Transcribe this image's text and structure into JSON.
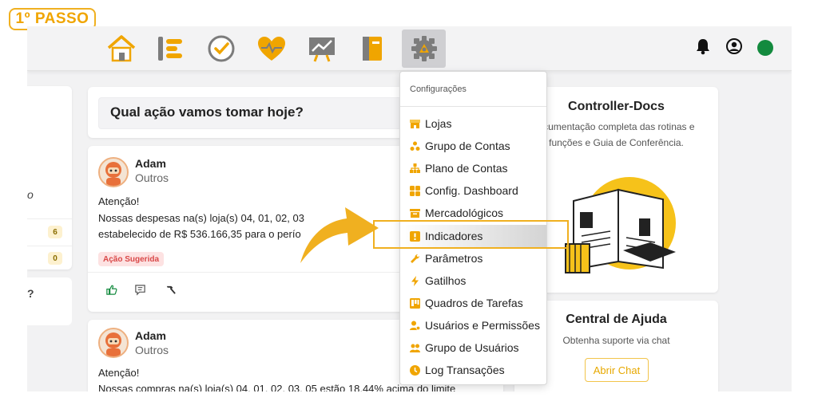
{
  "step_badge": "1º PASSO",
  "nav": {
    "icons": [
      "home-icon",
      "list-icon",
      "check-icon",
      "heart-icon",
      "chart-icon",
      "book-icon",
      "gear-icon"
    ],
    "active": "gear-icon"
  },
  "left": {
    "partial_text_1": "o",
    "badge_1": "6",
    "badge_2": "0",
    "partial_text_2": "?"
  },
  "feed": {
    "ask_placeholder": "Qual ação vamos tomar hoje?",
    "posts": [
      {
        "name": "Adam",
        "category": "Outros",
        "line1": "Atenção!",
        "line2": "Nossas despesas na(s) loja(s) 04, 01, 02, 03",
        "line3": "estabelecido de R$ 536.166,35 para o perío",
        "tag": "Ação Sugerida"
      },
      {
        "name": "Adam",
        "category": "Outros",
        "line1": "Atenção!",
        "line2": "Nossas compras na(s) loja(s) 04, 01, 02, 03, 05 estão 18,44% acima do limite"
      }
    ]
  },
  "docs": {
    "title": "Controller-Docs",
    "desc1": "ocumentação completa das rotinas e",
    "desc2": "funções e Guia de Conferência."
  },
  "help": {
    "title": "Central de Ajuda",
    "desc": "Obtenha suporte via chat",
    "button": "Abrir Chat"
  },
  "menu": {
    "header": "Configurações",
    "items": [
      {
        "label": "Lojas",
        "icon": "store-icon"
      },
      {
        "label": "Grupo de Contas",
        "icon": "account-group-icon"
      },
      {
        "label": "Plano de Contas",
        "icon": "hierarchy-icon"
      },
      {
        "label": "Config. Dashboard",
        "icon": "dashboard-icon"
      },
      {
        "label": "Mercadológicos",
        "icon": "box-icon"
      },
      {
        "label": "Indicadores",
        "icon": "indicator-icon"
      },
      {
        "label": "Parâmetros",
        "icon": "wrench-icon"
      },
      {
        "label": "Gatilhos",
        "icon": "bolt-icon"
      },
      {
        "label": "Quadros de Tarefas",
        "icon": "task-board-icon"
      },
      {
        "label": "Usuários e Permissões",
        "icon": "user-permissions-icon"
      },
      {
        "label": "Grupo de Usuários",
        "icon": "users-group-icon"
      },
      {
        "label": "Log Transações",
        "icon": "clock-icon"
      }
    ],
    "highlighted": "Indicadores"
  },
  "colors": {
    "accent": "#f0b020",
    "status_online": "#138a3e",
    "tag_red": "#d94848"
  }
}
